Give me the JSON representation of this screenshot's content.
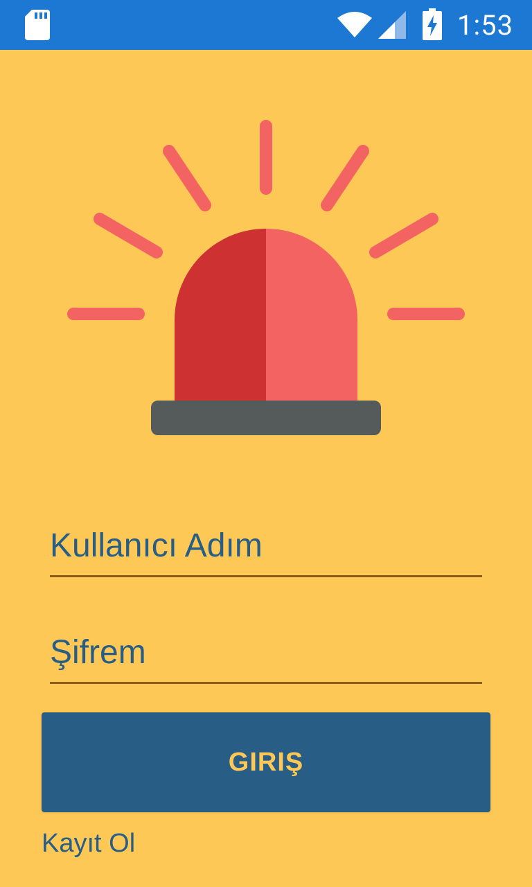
{
  "status_bar": {
    "time": "1:53",
    "color": "#1C78D2",
    "icons": [
      "sd-card-icon",
      "wifi-icon",
      "signal-icon",
      "battery-charging-icon"
    ]
  },
  "colors": {
    "background": "#FEC857",
    "primary": "#285E85",
    "siren_dark_red": "#CD3131",
    "siren_light_red": "#F26361",
    "siren_base": "#555A5A"
  },
  "form": {
    "username_placeholder": "Kullanıcı Adım",
    "password_placeholder": "Şifrem",
    "login_label": "GIRIŞ",
    "register_label": "Kayıt Ol"
  }
}
